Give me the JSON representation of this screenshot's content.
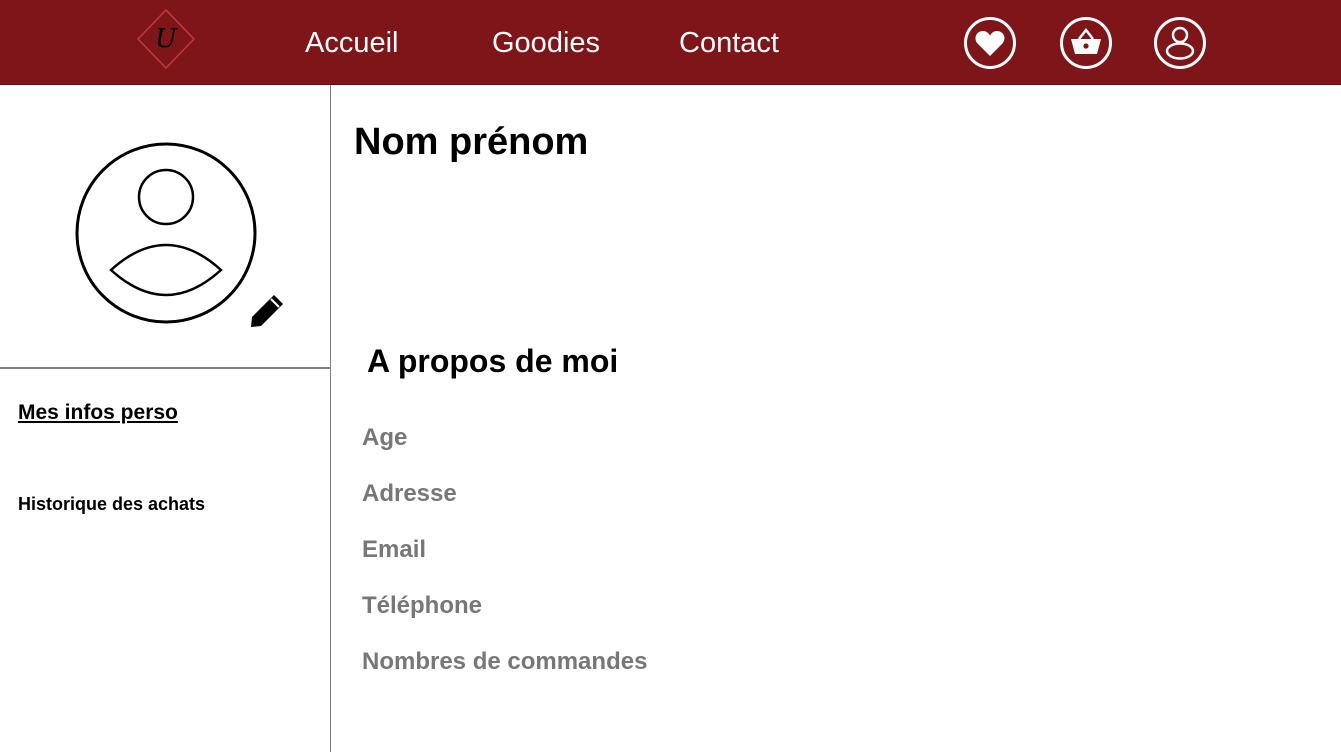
{
  "header": {
    "logo_text": "U",
    "nav": {
      "home": "Accueil",
      "goodies": "Goodies",
      "contact": "Contact"
    },
    "icons": {
      "favorites": "heart-icon",
      "cart": "basket-icon",
      "account": "user-icon"
    },
    "colors": {
      "background": "#7e1519",
      "text": "#ffffff"
    }
  },
  "sidebar": {
    "avatar_icon": "user-avatar-icon",
    "edit_icon": "pencil-icon",
    "links": {
      "personal_info": "Mes infos perso",
      "purchase_history": "Historique des achats"
    }
  },
  "profile": {
    "name": "Nom prénom",
    "about_title": "A propos de moi",
    "fields": {
      "age": "Age",
      "address": "Adresse",
      "email": "Email",
      "phone": "Téléphone",
      "orders": "Nombres de commandes"
    }
  }
}
